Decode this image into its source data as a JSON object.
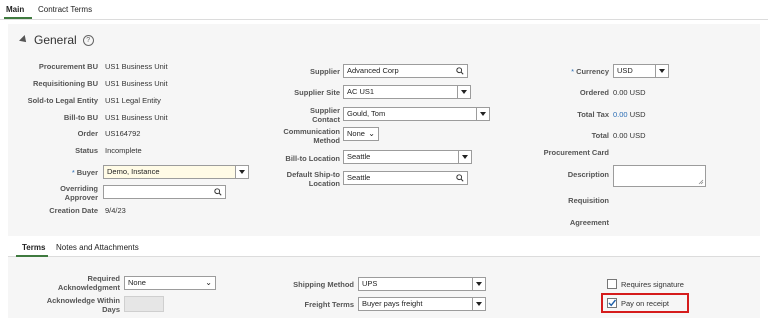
{
  "tabs": [
    {
      "label": "Main"
    },
    {
      "label": "Contract Terms"
    }
  ],
  "section": {
    "title": "General"
  },
  "left": {
    "procurement_bu": {
      "label": "Procurement BU",
      "value": "US1 Business Unit"
    },
    "requisitioning_bu": {
      "label": "Requisitioning BU",
      "value": "US1 Business Unit"
    },
    "sold_to": {
      "label": "Sold-to Legal Entity",
      "value": "US1 Legal Entity"
    },
    "bill_to_bu": {
      "label": "Bill-to BU",
      "value": "US1 Business Unit"
    },
    "order": {
      "label": "Order",
      "value": "US164792"
    },
    "status": {
      "label": "Status",
      "value": "Incomplete"
    },
    "buyer": {
      "label": "Buyer",
      "required": "*",
      "value": "Demo, Instance"
    },
    "overriding_approver": {
      "label1": "Overriding",
      "label2": "Approver",
      "value": ""
    },
    "creation_date": {
      "label": "Creation Date",
      "value": "9/4/23"
    }
  },
  "middle": {
    "supplier": {
      "label": "Supplier",
      "value": "Advanced Corp"
    },
    "supplier_site": {
      "label": "Supplier Site",
      "value": "AC US1"
    },
    "supplier_contact": {
      "label1": "Supplier",
      "label2": "Contact",
      "value": "Gould, Tom"
    },
    "comm_method": {
      "label1": "Communication",
      "label2": "Method",
      "value": "None"
    },
    "bill_to_location": {
      "label": "Bill-to Location",
      "value": "Seattle"
    },
    "ship_to_location": {
      "label1": "Default Ship-to",
      "label2": "Location",
      "value": "Seattle"
    }
  },
  "right": {
    "currency": {
      "label": "Currency",
      "required": "*",
      "value": "USD"
    },
    "ordered": {
      "label": "Ordered",
      "value": "0.00 USD"
    },
    "total_tax": {
      "label": "Total Tax",
      "amount": "0.00",
      "unit": "USD"
    },
    "total": {
      "label": "Total",
      "value": "0.00 USD"
    },
    "procurement_card": {
      "label": "Procurement Card"
    },
    "description": {
      "label": "Description",
      "value": ""
    },
    "requisition": {
      "label": "Requisition"
    },
    "agreement": {
      "label": "Agreement"
    }
  },
  "sub_tabs": [
    {
      "label": "Terms"
    },
    {
      "label": "Notes and Attachments"
    }
  ],
  "terms": {
    "required_ack": {
      "label1": "Required",
      "label2": "Acknowledgment",
      "value": "None"
    },
    "ack_within_days": {
      "label1": "Acknowledge Within",
      "label2": "Days",
      "value": ""
    },
    "shipping_method": {
      "label": "Shipping Method",
      "value": "UPS"
    },
    "freight_terms": {
      "label": "Freight Terms",
      "value": "Buyer pays freight"
    },
    "requires_signature": {
      "label": "Requires signature",
      "checked": false
    },
    "pay_on_receipt": {
      "label": "Pay on receipt",
      "checked": true
    }
  },
  "colors": {
    "accent": "#3f7a3f",
    "required": "#2a6db5",
    "highlight": "#d51c1c",
    "tax_link": "#2a6db5"
  },
  "icons": [
    "collapse-triangle-icon",
    "help-icon",
    "search-icon",
    "dropdown-caret-icon",
    "chevron-down-icon",
    "checkmark-icon",
    "resize-grip-icon"
  ]
}
